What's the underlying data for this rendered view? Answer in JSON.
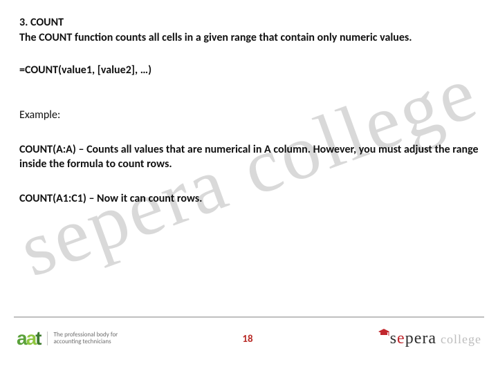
{
  "title_line": "3. COUNT",
  "intro": "The COUNT function counts all cells in a given range that contain only numeric values.",
  "syntax": "=COUNT(value1, [value2], …)",
  "example_label": "Example:",
  "example1_prefix": "COUNT(A:A) – ",
  "example1_rest": "Counts all values that are numerical in A column. However, you must adjust the range inside the formula to count rows.",
  "example2_prefix": "COUNT(A1:C1) – ",
  "example2_rest": "Now it can count rows.",
  "watermark": "sepera college",
  "footer": {
    "aat_a1": "a",
    "aat_a2": "a",
    "aat_t": "t",
    "aat_line1": "The professional body for",
    "aat_line2": "accounting technicians",
    "page": "18",
    "sepera_s": "s",
    "sepera_e1": "e",
    "sepera_p": "p",
    "sepera_e2": "e",
    "sepera_r": "r",
    "sepera_a": "a",
    "sepera_college": "college"
  }
}
